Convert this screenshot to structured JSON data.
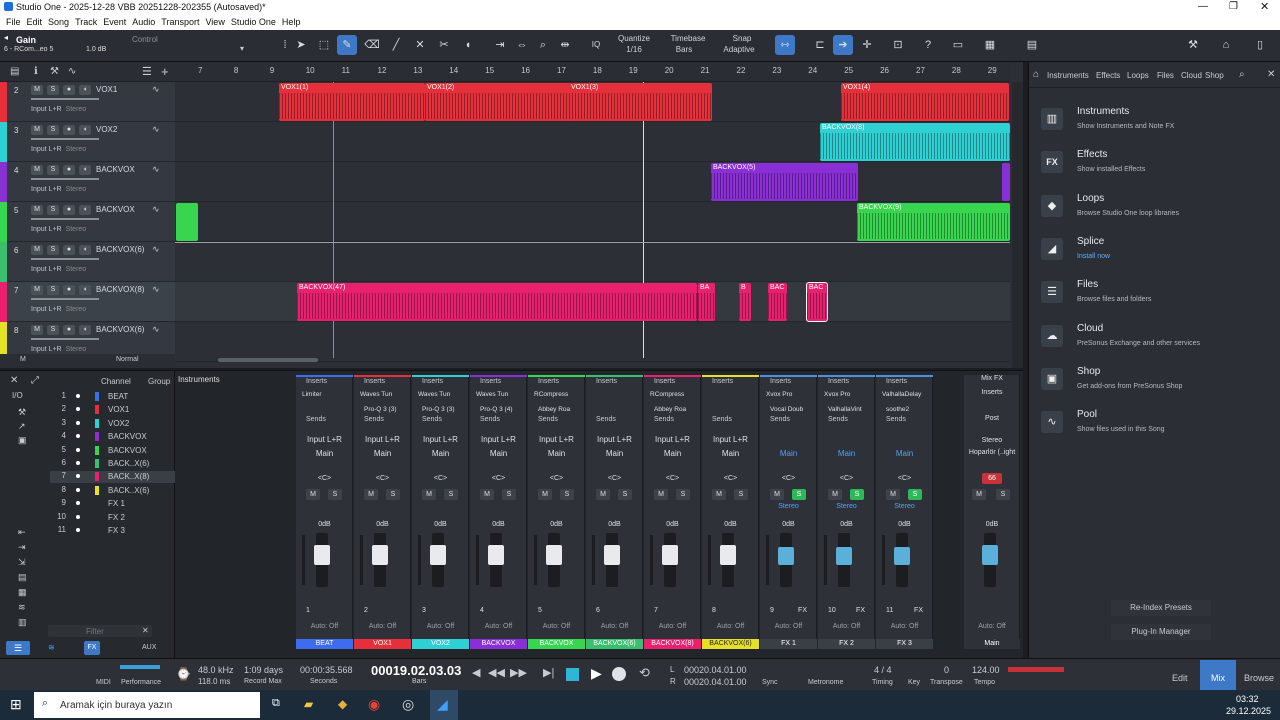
{
  "window": {
    "title": "Studio One - 2025-12-28 VBB 20251228-202355 (Autosaved)*"
  },
  "menu": [
    "File",
    "Edit",
    "Song",
    "Track",
    "Event",
    "Audio",
    "Transport",
    "View",
    "Studio One",
    "Help"
  ],
  "inspector": {
    "param": "Gain",
    "track": "6 - RCom...eo 5",
    "value": "1.0 dB",
    "mode": "Control"
  },
  "toolbar": {
    "quantize_label": "Quantize",
    "quantize": "1/16",
    "timebase_label": "Timebase",
    "timebase": "Bars",
    "snap_label": "Snap",
    "snap": "Adaptive",
    "iq": "IQ"
  },
  "ruler": [
    "7",
    "8",
    "9",
    "10",
    "11",
    "12",
    "13",
    "14",
    "15",
    "16",
    "17",
    "18",
    "19",
    "20",
    "21",
    "22",
    "23",
    "24",
    "25",
    "26",
    "27",
    "28",
    "29"
  ],
  "tracks": [
    {
      "num": "2",
      "name": "VOX1",
      "input": "Input L+R",
      "mode": "Stereo",
      "color": "#e5303b"
    },
    {
      "num": "3",
      "name": "VOX2",
      "input": "Input L+R",
      "mode": "Stereo",
      "color": "#2fd0d3"
    },
    {
      "num": "4",
      "name": "BACKVOX",
      "input": "Input L+R",
      "mode": "Stereo",
      "color": "#8a2fd6"
    },
    {
      "num": "5",
      "name": "BACKVOX",
      "input": "Input L+R",
      "mode": "Stereo",
      "color": "#38d64f"
    },
    {
      "num": "6",
      "name": "BACKVOX(6)",
      "input": "Input L+R",
      "mode": "Stereo",
      "color": "#39c06f"
    },
    {
      "num": "7",
      "name": "BACKVOX(8)",
      "input": "Input L+R",
      "mode": "Stereo",
      "color": "#e8206e"
    },
    {
      "num": "8",
      "name": "BACKVOX(6)",
      "input": "Input L+R",
      "mode": "Stereo",
      "color": "#e6e02a"
    }
  ],
  "clips": {
    "vox1": [
      "VOX1(1)",
      "VOX1(2)",
      "VOX1(3)",
      "VOX1(4)"
    ],
    "vox2": [
      "BACKVOX(8)"
    ],
    "backvox": [
      "BACKVOX(5)"
    ],
    "backvox5": [
      "BACKVOX(9)"
    ],
    "backvox8": [
      "BACKVOX(47)",
      "BA",
      "B",
      "BAC",
      "BAC"
    ]
  },
  "footer_track": {
    "m": "M",
    "normal": "Normal"
  },
  "channel_list": {
    "headers": [
      "Channel",
      "Group",
      "Instruments"
    ],
    "side": [
      "I/O"
    ],
    "rows": [
      {
        "n": "1",
        "name": "BEAT",
        "color": "#3d6cf0"
      },
      {
        "n": "2",
        "name": "VOX1",
        "color": "#e5303b"
      },
      {
        "n": "3",
        "name": "VOX2",
        "color": "#2fd0d3"
      },
      {
        "n": "4",
        "name": "BACKVOX",
        "color": "#8a2fd6"
      },
      {
        "n": "5",
        "name": "BACKVOX",
        "color": "#38d64f"
      },
      {
        "n": "6",
        "name": "BACK..X(6)",
        "color": "#39c06f"
      },
      {
        "n": "7",
        "name": "BACK..X(8)",
        "color": "#e8206e"
      },
      {
        "n": "8",
        "name": "BACK..X(6)",
        "color": "#e6e02a"
      },
      {
        "n": "9",
        "name": "FX 1",
        "color": ""
      },
      {
        "n": "10",
        "name": "FX 2",
        "color": ""
      },
      {
        "n": "11",
        "name": "FX 3",
        "color": ""
      }
    ],
    "filter": "Filter"
  },
  "channels": [
    {
      "name": "BEAT",
      "color": "#3d6cf0",
      "insert": "Limiter",
      "insert2": "",
      "input": "Input L+R",
      "out": "Main",
      "db": "0dB",
      "num": "1",
      "auto": "Auto: Off"
    },
    {
      "name": "VOX1",
      "color": "#e5303b",
      "insert": "Waves Tun",
      "insert2": "Pro-Q 3 (3)",
      "input": "Input L+R",
      "out": "Main",
      "db": "0dB",
      "num": "2",
      "auto": "Auto: Off"
    },
    {
      "name": "VOX2",
      "color": "#2fd0d3",
      "insert": "Waves Tun",
      "insert2": "Pro-Q 3 (3)",
      "input": "Input L+R",
      "out": "Main",
      "db": "0dB",
      "num": "3",
      "auto": "Auto: Off"
    },
    {
      "name": "BACKVOX",
      "color": "#8a2fd6",
      "insert": "Waves Tun",
      "insert2": "Pro-Q 3 (4)",
      "input": "Input L+R",
      "out": "Main",
      "db": "0dB",
      "num": "4",
      "auto": "Auto: Off"
    },
    {
      "name": "BACKVOX",
      "color": "#38d64f",
      "insert": "RCompress",
      "insert2": "Abbey Roa",
      "input": "Input L+R",
      "out": "Main",
      "db": "0dB",
      "num": "5",
      "auto": "Auto: Off"
    },
    {
      "name": "BACKVOX(6)",
      "color": "#39c06f",
      "insert": "",
      "insert2": "",
      "input": "Input L+R",
      "out": "Main",
      "db": "0dB",
      "num": "6",
      "auto": "Auto: Off"
    },
    {
      "name": "BACKVOX(8)",
      "color": "#e8206e",
      "insert": "RCompress",
      "insert2": "Abbey Roa",
      "input": "Input L+R",
      "out": "Main",
      "db": "0dB",
      "num": "7",
      "auto": "Auto: Off"
    },
    {
      "name": "BACKVOX(6)",
      "color": "#e6e02a",
      "insert": "",
      "insert2": "",
      "input": "Input L+R",
      "out": "Main",
      "db": "0dB",
      "num": "8",
      "auto": "Auto: Off"
    },
    {
      "name": "FX 1",
      "color": "#3a3f46",
      "insert": "Xvox Pro",
      "insert2": "Vocal Doub",
      "input": "",
      "out": "Main",
      "db": "0dB",
      "num": "9",
      "auto": "Auto: Off",
      "stereo": "Stereo"
    },
    {
      "name": "FX 2",
      "color": "#3a3f46",
      "insert": "Xvox Pro",
      "insert2": "ValhallaVint",
      "input": "",
      "out": "Main",
      "db": "0dB",
      "num": "10",
      "auto": "Auto: Off",
      "stereo": "Stereo"
    },
    {
      "name": "FX 3",
      "color": "#3a3f46",
      "insert": "ValhallaDelay",
      "insert2": "soothe2",
      "input": "",
      "out": "Main",
      "db": "0dB",
      "num": "11",
      "auto": "Auto: Off",
      "stereo": "Stereo"
    }
  ],
  "mixer_labels": {
    "inserts": "Inserts",
    "sends": "Sends",
    "pan": "<C>",
    "m": "M",
    "s": "S",
    "fx": "FX"
  },
  "main_bus": {
    "title": "Mix FX",
    "inserts": "Inserts",
    "post": "Post",
    "stereo": "Stereo",
    "out": "Hoparlör (..ight",
    "value": "66",
    "db": "0dB",
    "auto": "Auto: Off",
    "name": "Main"
  },
  "browser": {
    "tabs": [
      "Instruments",
      "Effects",
      "Loops",
      "Files",
      "Cloud",
      "Shop"
    ],
    "items": [
      {
        "name": "Instruments",
        "desc": "Show Instruments and Note FX",
        "icon": "▥"
      },
      {
        "name": "Effects",
        "desc": "Show installed Effects",
        "icon": "FX"
      },
      {
        "name": "Loops",
        "desc": "Browse Studio One loop libraries",
        "icon": "◆"
      },
      {
        "name": "Splice",
        "desc": "Install now",
        "icon": "◢"
      },
      {
        "name": "Files",
        "desc": "Browse files and folders",
        "icon": "☰"
      },
      {
        "name": "Cloud",
        "desc": "PreSonus Exchange and other services",
        "icon": "☁"
      },
      {
        "name": "Shop",
        "desc": "Get add-ons from PreSonus Shop",
        "icon": "▣"
      },
      {
        "name": "Pool",
        "desc": "Show files used in this Song",
        "icon": "∿"
      }
    ],
    "reindex": "Re-Index Presets",
    "plugin_manager": "Plug-In Manager"
  },
  "transport": {
    "midi": "MIDI",
    "performance": "Performance",
    "rate": "48.0 kHz",
    "latency": "118.0 ms",
    "days": "1:09 days",
    "record_max": "Record Max",
    "seconds_val": "00:00:35.568",
    "seconds": "Seconds",
    "bars_val": "00019.02.03.03",
    "bars": "Bars",
    "l_val": "00020.04.01.00",
    "r_val": "00020.04.01.00",
    "l": "L",
    "r": "R",
    "sync": "Sync",
    "metronome": "Metronome",
    "timing_val": "4 / 4",
    "timing": "Timing",
    "key": "Key",
    "transpose_val": "0",
    "transpose": "Transpose",
    "tempo_val": "124.00",
    "tempo": "Tempo",
    "edit": "Edit",
    "mix": "Mix",
    "browse": "Browse"
  },
  "taskbar": {
    "search": "Aramak için buraya yazın",
    "time": "03:32",
    "date": "29.12.2025"
  }
}
